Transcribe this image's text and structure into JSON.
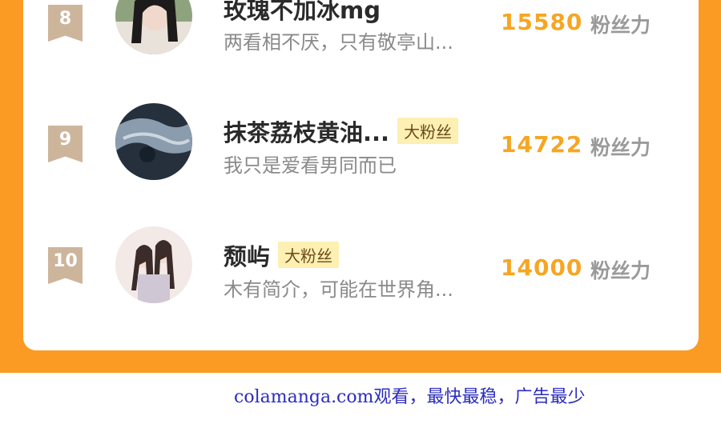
{
  "unit_label": "粉丝力",
  "badge_label": "大粉丝",
  "rows": [
    {
      "rank": "8",
      "name": "玫瑰不加冰mg",
      "bio": "两看相不厌，只有敬亭山...",
      "score": "15580"
    },
    {
      "rank": "9",
      "name": "抹茶荔枝黄油...",
      "bio": "我只是爱看男同而已",
      "score": "14722"
    },
    {
      "rank": "10",
      "name": "颓屿",
      "bio": "木有简介，可能在世界角...",
      "score": "14000"
    }
  ],
  "footer": "colamanga.com观看，最快最稳，广告最少",
  "colors": {
    "accent_orange": "#fb9b23",
    "score": "#f5a623",
    "badge_bg": "#fdf0b2"
  }
}
